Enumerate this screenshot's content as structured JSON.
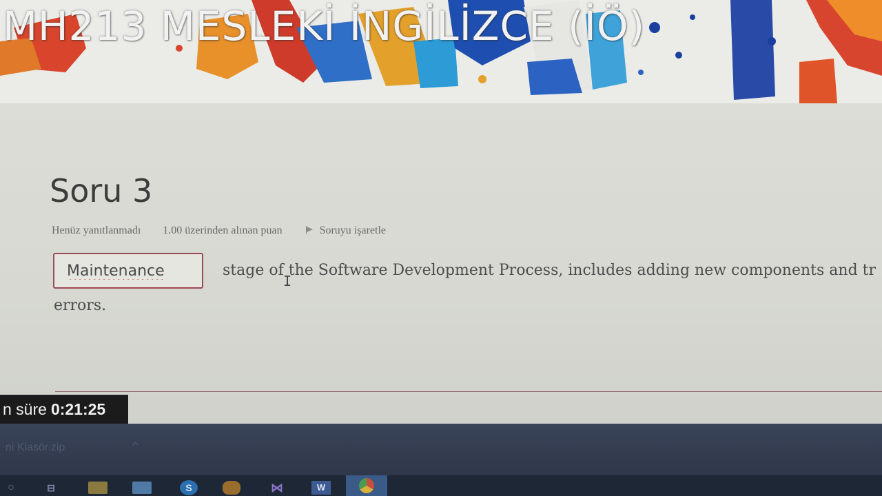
{
  "course": {
    "title": "MH213 MESLEKİ İNGİLİZCE (İÖ)"
  },
  "question": {
    "title": "Soru 3",
    "state": "Henüz yanıtlanmadı",
    "grade": "1.00 üzerinden alınan puan",
    "flag_label": "Soruyu işaretle",
    "answer_value": "Maintenance",
    "text_line1": "stage of the Software Development Process, includes adding new components and tr",
    "text_line2": "errors."
  },
  "timer": {
    "label": "n süre",
    "value": "0:21:25"
  },
  "download_bar": {
    "file_name": "ni Klasör.zip",
    "chevron": "^"
  },
  "taskbar": {
    "icons": [
      "search-icon",
      "task-view-icon",
      "file-explorer-icon",
      "store-icon",
      "skype-icon",
      "photos-icon",
      "visual-studio-icon",
      "word-icon",
      "chrome-icon"
    ],
    "skype_letter": "S",
    "word_letter": "W",
    "vs_glyph": "⋈",
    "search_glyph": "○",
    "taskview_glyph": "⊟"
  },
  "colors": {
    "input_border": "#9b4a55",
    "timer_bg": "#1b1b1b",
    "taskbar_bg": "#1d2736",
    "download_bar_bg": "#343d52",
    "active_task": "#3a5a88"
  }
}
